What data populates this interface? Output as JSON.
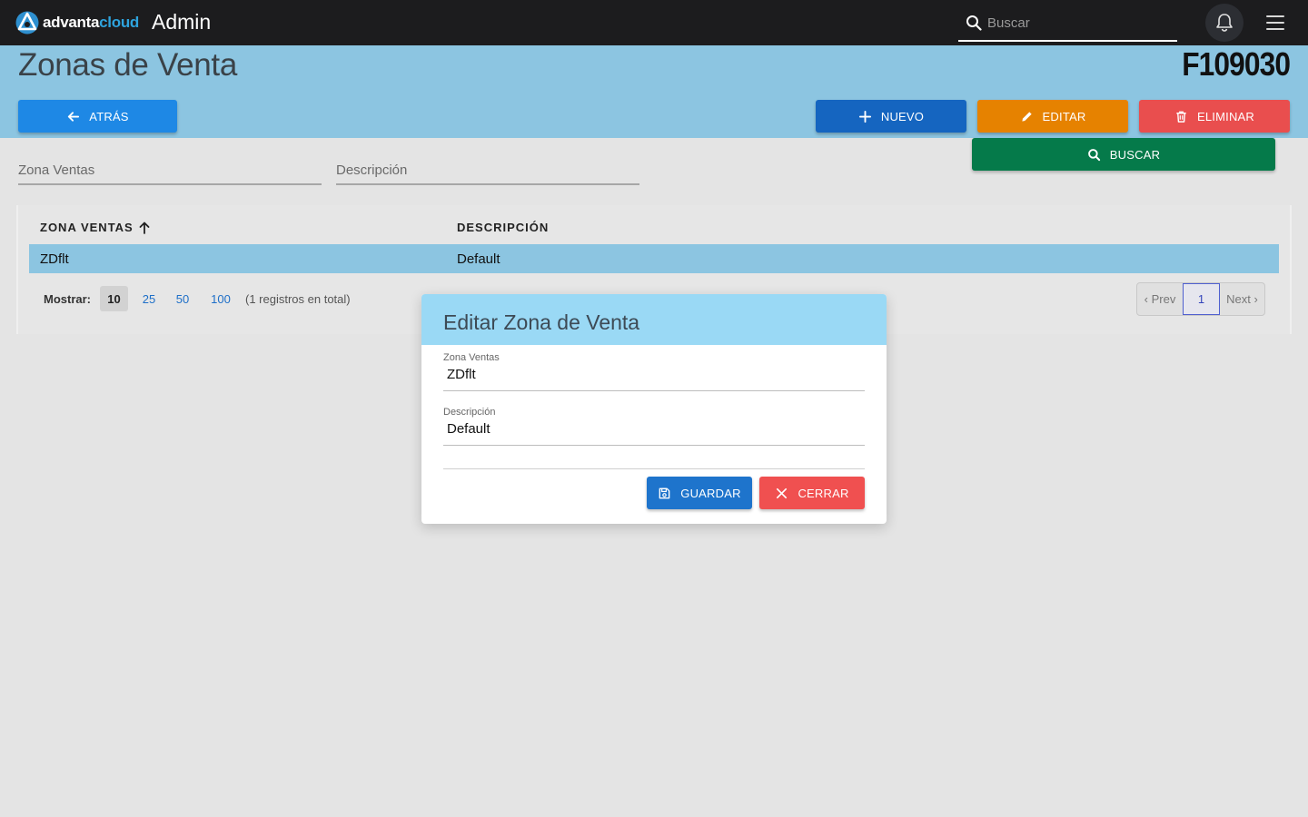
{
  "topbar": {
    "brand_part1": "advanta",
    "brand_part2": "cloud",
    "app_title": "Admin",
    "search_placeholder": "Buscar"
  },
  "header": {
    "title": "Zonas de Venta",
    "code": "F109030"
  },
  "actions": {
    "back": "ATRÁS",
    "new": "NUEVO",
    "edit": "EDITAR",
    "delete": "ELIMINAR",
    "search": "BUSCAR"
  },
  "filters": {
    "zona_placeholder": "Zona Ventas",
    "descripcion_placeholder": "Descripción"
  },
  "table": {
    "columns": [
      "ZONA VENTAS",
      "DESCRIPCIÓN"
    ],
    "sort": "ascending",
    "rows": [
      {
        "zona": "ZDflt",
        "descripcion": "Default"
      }
    ]
  },
  "footer": {
    "show_label": "Mostrar:",
    "page_sizes": [
      "10",
      "25",
      "50",
      "100"
    ],
    "selected_page_size": "10",
    "total_text": "(1 registros en total)",
    "pager": {
      "prev": "‹ Prev",
      "current": "1",
      "next": "Next ›"
    }
  },
  "modal": {
    "title": "Editar Zona de Venta",
    "fields": [
      {
        "label": "Zona Ventas",
        "value": "ZDflt"
      },
      {
        "label": "Descripción",
        "value": "Default"
      }
    ],
    "save": "GUARDAR",
    "close": "CERRAR"
  },
  "colors": {
    "topbar": "#1c1c1e",
    "band": "#8cc5e1",
    "back": "#1e88e5",
    "new": "#1565c0",
    "edit": "#e68200",
    "delete": "#e94e4e",
    "search": "#057a4a",
    "modal_header": "#9ad9f5"
  }
}
